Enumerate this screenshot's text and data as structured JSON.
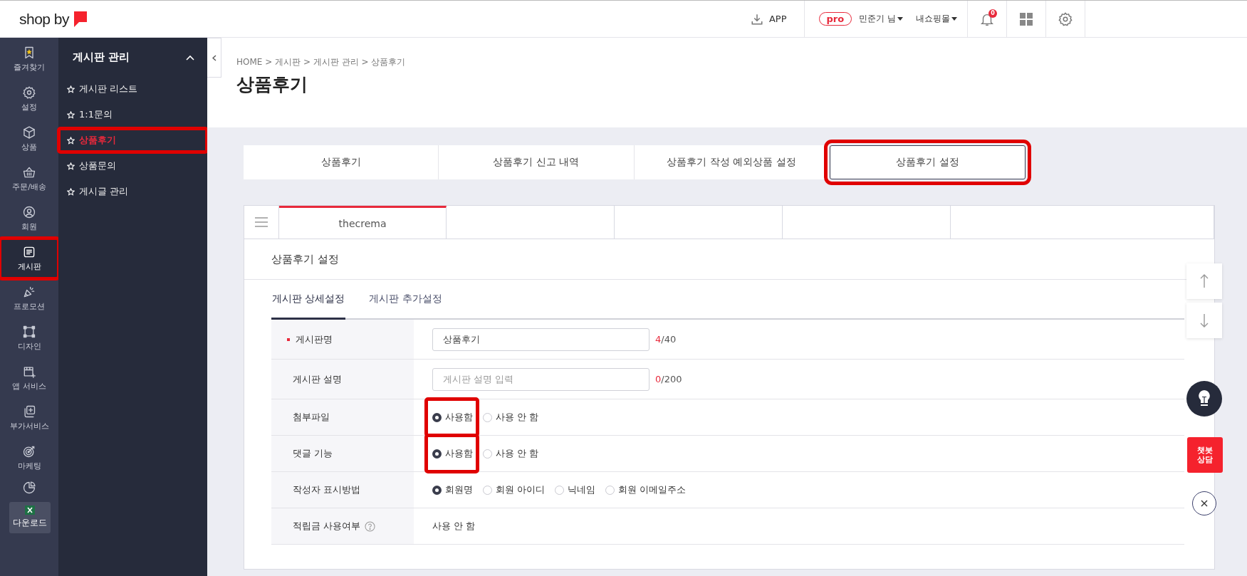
{
  "logo": {
    "text": "shop by"
  },
  "topbar": {
    "app": "APP",
    "badge": "pro",
    "user": "민준기 님",
    "mall": "내쇼핑몰",
    "notifications": "0"
  },
  "rail": [
    {
      "label": "즐겨찾기",
      "selected": false,
      "highlighted": false
    },
    {
      "label": "설정",
      "selected": false,
      "highlighted": false
    },
    {
      "label": "상품",
      "selected": false,
      "highlighted": false
    },
    {
      "label": "주문/배송",
      "selected": false,
      "highlighted": false
    },
    {
      "label": "회원",
      "selected": false,
      "highlighted": false
    },
    {
      "label": "게시판",
      "selected": true,
      "highlighted": true
    },
    {
      "label": "프로모션",
      "selected": false,
      "highlighted": false
    },
    {
      "label": "디자인",
      "selected": false,
      "highlighted": false
    },
    {
      "label": "앱 서비스",
      "selected": false,
      "highlighted": false
    },
    {
      "label": "부가서비스",
      "selected": false,
      "highlighted": false
    },
    {
      "label": "마케팅",
      "selected": false,
      "highlighted": false
    },
    {
      "selected": false,
      "highlighted": false
    }
  ],
  "download": "다운로드",
  "menu": {
    "title": "게시판 관리",
    "expanded": true,
    "items": [
      {
        "label": "게시판 리스트",
        "selected": false,
        "highlighted": false
      },
      {
        "label": "1:1문의",
        "selected": false,
        "highlighted": false
      },
      {
        "label": "상품후기",
        "selected": true,
        "highlighted": true
      },
      {
        "label": "상품문의",
        "selected": false,
        "highlighted": false
      },
      {
        "label": "게시글 관리",
        "selected": false,
        "highlighted": false
      }
    ]
  },
  "breadcrumb": "HOME > 게시판 > 게시판 관리 > 상품후기",
  "page_title": "상품후기",
  "tabs": [
    {
      "label": "상품후기",
      "selected": false,
      "highlighted": false
    },
    {
      "label": "상품후기 신고 내역",
      "selected": false,
      "highlighted": false
    },
    {
      "label": "상품후기 작성 예외상품 설정",
      "selected": false,
      "highlighted": false
    },
    {
      "label": "상품후기 설정",
      "selected": true,
      "highlighted": true
    }
  ],
  "mall_tabs": [
    {
      "label": "thecrema",
      "selected": true
    }
  ],
  "section_title": "상품후기 설정",
  "sub_tabs": [
    {
      "label": "게시판 상세설정",
      "selected": true
    },
    {
      "label": "게시판 추가설정",
      "selected": false
    }
  ],
  "form": [
    {
      "kind": "text",
      "label": "게시판명",
      "required": true,
      "value": "상품후기",
      "count": "4",
      "limit": "/40"
    },
    {
      "kind": "text",
      "label": "게시판 설명",
      "required": false,
      "placeholder": "게시판 설명 입력",
      "count": "0",
      "limit": "/200"
    },
    {
      "kind": "radio",
      "label": "첨부파일",
      "required": false,
      "options": [
        {
          "label": "사용함",
          "selected": true,
          "highlighted": true
        },
        {
          "label": "사용 안 함",
          "selected": false,
          "highlighted": false
        }
      ]
    },
    {
      "kind": "radio",
      "label": "댓글 기능",
      "required": false,
      "options": [
        {
          "label": "사용함",
          "selected": true,
          "highlighted": true
        },
        {
          "label": "사용 안 함",
          "selected": false,
          "highlighted": false
        }
      ]
    },
    {
      "kind": "radio",
      "label": "작성자 표시방법",
      "required": false,
      "options": [
        {
          "label": "회원명",
          "selected": true,
          "highlighted": false
        },
        {
          "label": "회원 아이디",
          "selected": false,
          "highlighted": false
        },
        {
          "label": "닉네임",
          "selected": false,
          "highlighted": false
        },
        {
          "label": "회원 이메일주소",
          "selected": false,
          "highlighted": false
        }
      ]
    },
    {
      "kind": "static",
      "label": "적립금 사용여부",
      "required": false,
      "help": true,
      "value": "사용 안 함"
    }
  ],
  "chatbot": "챗봇 상담"
}
